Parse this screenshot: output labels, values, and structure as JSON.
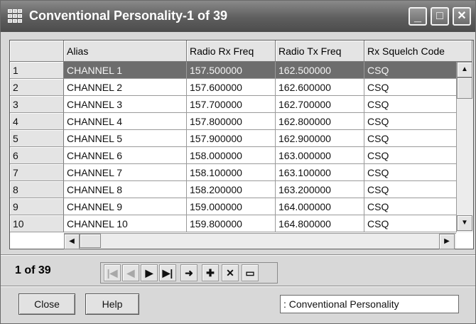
{
  "window": {
    "title": "Conventional Personality-1 of 39",
    "minimize": "_",
    "maximize": "□",
    "close": "✕"
  },
  "grid": {
    "columns": [
      "Alias",
      "Radio Rx Freq",
      "Radio Tx Freq",
      "Rx Squelch Code"
    ],
    "selected_row": 0,
    "rows": [
      {
        "num": "1",
        "alias": "CHANNEL 1",
        "rx": "157.500000",
        "tx": "162.500000",
        "sq": "CSQ"
      },
      {
        "num": "2",
        "alias": "CHANNEL 2",
        "rx": "157.600000",
        "tx": "162.600000",
        "sq": "CSQ"
      },
      {
        "num": "3",
        "alias": "CHANNEL 3",
        "rx": "157.700000",
        "tx": "162.700000",
        "sq": "CSQ"
      },
      {
        "num": "4",
        "alias": "CHANNEL 4",
        "rx": "157.800000",
        "tx": "162.800000",
        "sq": "CSQ"
      },
      {
        "num": "5",
        "alias": "CHANNEL 5",
        "rx": "157.900000",
        "tx": "162.900000",
        "sq": "CSQ"
      },
      {
        "num": "6",
        "alias": "CHANNEL 6",
        "rx": "158.000000",
        "tx": "163.000000",
        "sq": "CSQ"
      },
      {
        "num": "7",
        "alias": "CHANNEL 7",
        "rx": "158.100000",
        "tx": "163.100000",
        "sq": "CSQ"
      },
      {
        "num": "8",
        "alias": "CHANNEL 8",
        "rx": "158.200000",
        "tx": "163.200000",
        "sq": "CSQ"
      },
      {
        "num": "9",
        "alias": "CHANNEL 9",
        "rx": "159.000000",
        "tx": "164.000000",
        "sq": "CSQ"
      },
      {
        "num": "10",
        "alias": "CHANNEL 10",
        "rx": "159.800000",
        "tx": "164.800000",
        "sq": "CSQ"
      }
    ]
  },
  "navigator": {
    "record_count": "1 of 39",
    "buttons": [
      {
        "name": "first-record-button",
        "icon": "first-icon",
        "glyph": "|◀",
        "disabled": true
      },
      {
        "name": "prior-record-button",
        "icon": "prior-icon",
        "glyph": "◀",
        "disabled": true
      },
      {
        "name": "next-record-button",
        "icon": "next-icon",
        "glyph": "▶",
        "disabled": false
      },
      {
        "name": "last-record-button",
        "icon": "last-icon",
        "glyph": "▶|",
        "disabled": false
      },
      {
        "name": "go-to-record-button",
        "icon": "arrow-right-icon",
        "glyph": "➜",
        "disabled": false
      },
      {
        "name": "insert-record-button",
        "icon": "plus-icon",
        "glyph": "✚",
        "disabled": false
      },
      {
        "name": "delete-record-button",
        "icon": "delete-x-icon",
        "glyph": "✕",
        "disabled": false
      },
      {
        "name": "folder-button",
        "icon": "folder-icon",
        "glyph": "▭",
        "disabled": false
      }
    ]
  },
  "footer": {
    "close_label": "Close",
    "help_label": "Help",
    "status_text": ": Conventional Personality"
  }
}
